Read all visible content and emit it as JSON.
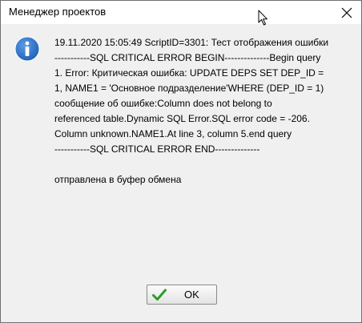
{
  "window": {
    "title": "Менеджер проектов"
  },
  "message": {
    "lines": [
      "19.11.2020 15:05:49 ScriptID=3301: Тест отображения ошибки",
      "-----------SQL CRITICAL ERROR BEGIN--------------Begin query",
      "1. Error: Критическая ошибка: UPDATE DEPS SET     DEP_ID =",
      "1,     NAME1 = 'Основное подразделение'WHERE (DEP_ID = 1)",
      "сообщение об ошибке:Column does not belong to",
      "referenced table.Dynamic SQL Error.SQL error code = -206.",
      "Column unknown.NAME1.At line 3, column 5.end query",
      "-----------SQL CRITICAL ERROR END--------------",
      "",
      "отправлена в буфер обмена"
    ]
  },
  "buttons": {
    "ok_label": "OK"
  },
  "icons": {
    "info": "info-icon",
    "close": "close-icon",
    "check": "checkmark-icon",
    "cursor": "mouse-cursor-icon"
  },
  "colors": {
    "info_icon": "#1f5fb3",
    "check": "#2e9b2e"
  }
}
